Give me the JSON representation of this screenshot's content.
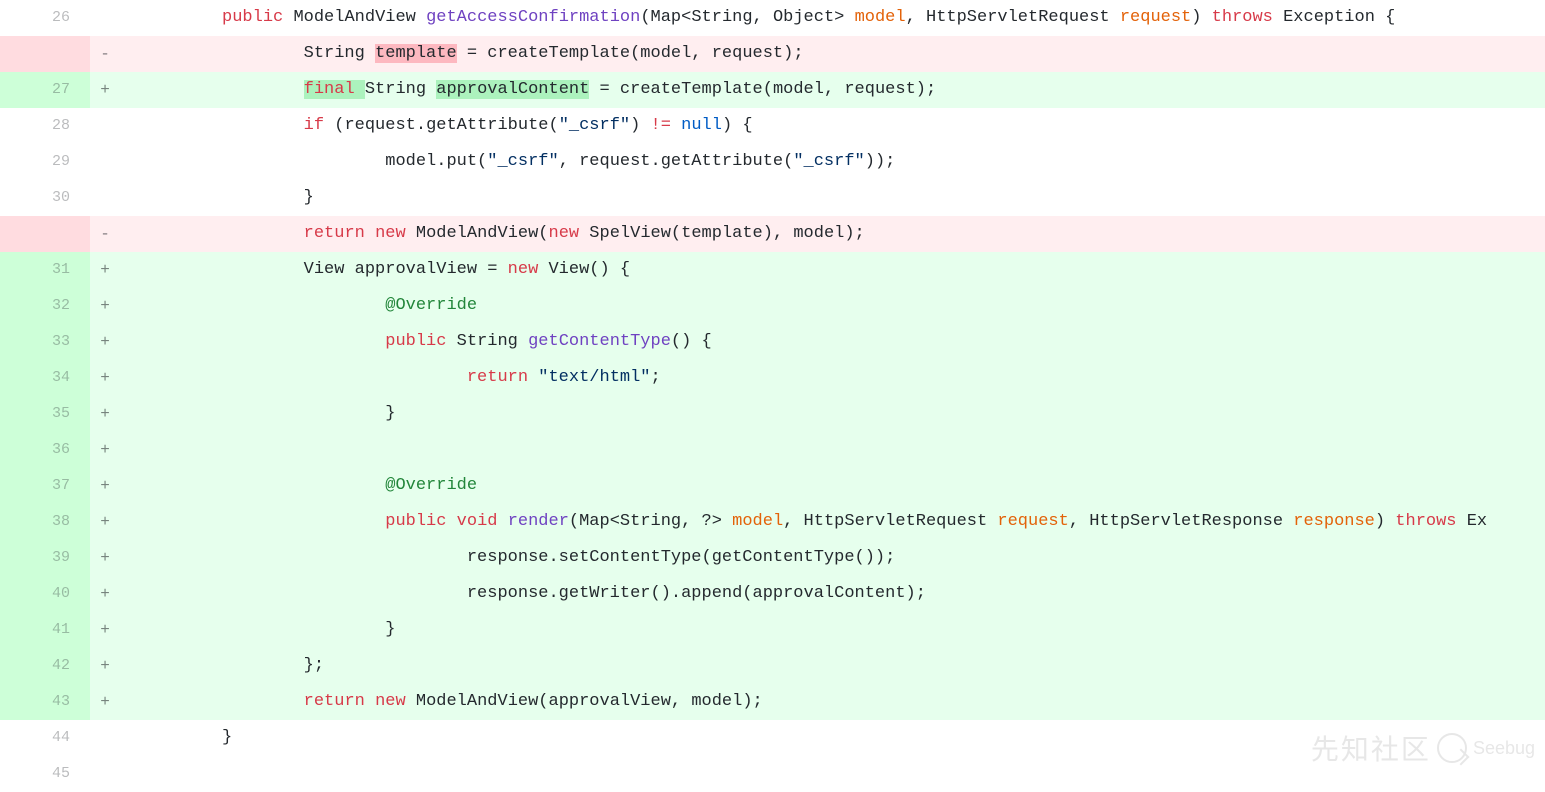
{
  "diff": {
    "lines": [
      {
        "num": "26",
        "marker": "",
        "type": "ctx",
        "code": "          <span class='tk-kw'>public</span> ModelAndView <span class='tk-fn'>getAccessConfirmation</span>(Map&lt;String, Object&gt; <span class='tk-var'>model</span>, HttpServletRequest <span class='tk-var'>request</span>) <span class='tk-kw'>throws</span> Exception {"
      },
      {
        "num": "",
        "marker": "-",
        "type": "del",
        "code": "                  String <span class='hl-del'>template</span> = createTemplate(model, request);"
      },
      {
        "num": "27",
        "marker": "+",
        "type": "add",
        "code": "                  <span class='hl-add'><span class='tk-kw'>final</span> </span>String <span class='hl-add'>approvalContent</span> = createTemplate(model, request);"
      },
      {
        "num": "28",
        "marker": "",
        "type": "ctx",
        "code": "                  <span class='tk-kw'>if</span> (request.getAttribute(<span class='tk-str'>\"_csrf\"</span>) <span class='tk-kw'>!=</span> <span class='tk-const'>null</span>) {"
      },
      {
        "num": "29",
        "marker": "",
        "type": "ctx",
        "code": "                          model.put(<span class='tk-str'>\"_csrf\"</span>, request.getAttribute(<span class='tk-str'>\"_csrf\"</span>));"
      },
      {
        "num": "30",
        "marker": "",
        "type": "ctx",
        "code": "                  }"
      },
      {
        "num": "",
        "marker": "-",
        "type": "del",
        "code": "                  <span class='tk-kw'>return</span> <span class='tk-kw'>new</span> ModelAndView(<span class='tk-kw'>new</span> SpelView(template), model);"
      },
      {
        "num": "31",
        "marker": "+",
        "type": "add",
        "code": "                  View approvalView = <span class='tk-kw'>new</span> View() {"
      },
      {
        "num": "32",
        "marker": "+",
        "type": "add",
        "code": "                          <span class='tk-ann'>@Override</span>"
      },
      {
        "num": "33",
        "marker": "+",
        "type": "add",
        "code": "                          <span class='tk-kw'>public</span> String <span class='tk-fn'>getContentType</span>() {"
      },
      {
        "num": "34",
        "marker": "+",
        "type": "add",
        "code": "                                  <span class='tk-kw'>return</span> <span class='tk-str'>\"text/html\"</span>;"
      },
      {
        "num": "35",
        "marker": "+",
        "type": "add",
        "code": "                          }"
      },
      {
        "num": "36",
        "marker": "+",
        "type": "add",
        "code": ""
      },
      {
        "num": "37",
        "marker": "+",
        "type": "add",
        "code": "                          <span class='tk-ann'>@Override</span>"
      },
      {
        "num": "38",
        "marker": "+",
        "type": "add",
        "code": "                          <span class='tk-kw'>public</span> <span class='tk-kw'>void</span> <span class='tk-fn'>render</span>(Map&lt;String, ?&gt; <span class='tk-var'>model</span>, HttpServletRequest <span class='tk-var'>request</span>, HttpServletResponse <span class='tk-var'>response</span>) <span class='tk-kw'>throws</span> Ex"
      },
      {
        "num": "39",
        "marker": "+",
        "type": "add",
        "code": "                                  response.setContentType(getContentType());"
      },
      {
        "num": "40",
        "marker": "+",
        "type": "add",
        "code": "                                  response.getWriter().append(approvalContent);"
      },
      {
        "num": "41",
        "marker": "+",
        "type": "add",
        "code": "                          }"
      },
      {
        "num": "42",
        "marker": "+",
        "type": "add",
        "code": "                  };"
      },
      {
        "num": "43",
        "marker": "+",
        "type": "add",
        "code": "                  <span class='tk-kw'>return</span> <span class='tk-kw'>new</span> ModelAndView(approvalView, model);"
      },
      {
        "num": "44",
        "marker": "",
        "type": "ctx",
        "code": "          }"
      },
      {
        "num": "45",
        "marker": "",
        "type": "ctx",
        "code": ""
      }
    ]
  },
  "watermark": {
    "zh": "先知社区",
    "sb": "Seebug"
  }
}
